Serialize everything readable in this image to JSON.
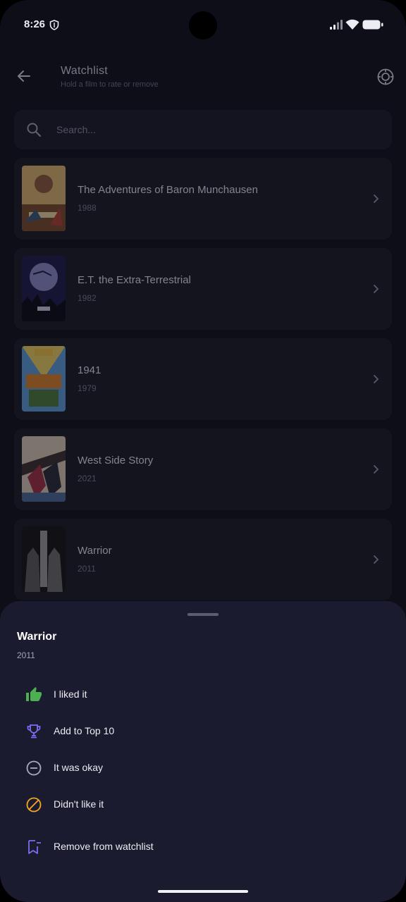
{
  "status_bar": {
    "time": "8:26"
  },
  "header": {
    "title": "Watchlist",
    "subtitle": "Hold a film to rate or remove"
  },
  "search": {
    "placeholder": "Search..."
  },
  "films": [
    {
      "title": "The Adventures of Baron Munchausen",
      "year": "1988"
    },
    {
      "title": "E.T. the Extra-Terrestrial",
      "year": "1982"
    },
    {
      "title": "1941",
      "year": "1979"
    },
    {
      "title": "West Side Story",
      "year": "2021"
    },
    {
      "title": "Warrior",
      "year": "2011"
    }
  ],
  "sheet": {
    "title": "Warrior",
    "year": "2011",
    "actions": [
      {
        "label": "I liked it",
        "icon": "thumb-up-icon",
        "color": "#4caf50"
      },
      {
        "label": "Add to Top 10",
        "icon": "trophy-icon",
        "color": "#7c6cf0"
      },
      {
        "label": "It was okay",
        "icon": "minus-circle-icon",
        "color": "#a9aabb"
      },
      {
        "label": "Didn't like it",
        "icon": "block-icon",
        "color": "#f5a623"
      },
      {
        "label": "Remove from watchlist",
        "icon": "bookmark-remove-icon",
        "color": "#7c6cf0"
      }
    ]
  },
  "colors": {
    "background": "#0e0e18",
    "card": "#191926",
    "sheet": "#1b1b2f",
    "accent": "#7c6cf0"
  }
}
